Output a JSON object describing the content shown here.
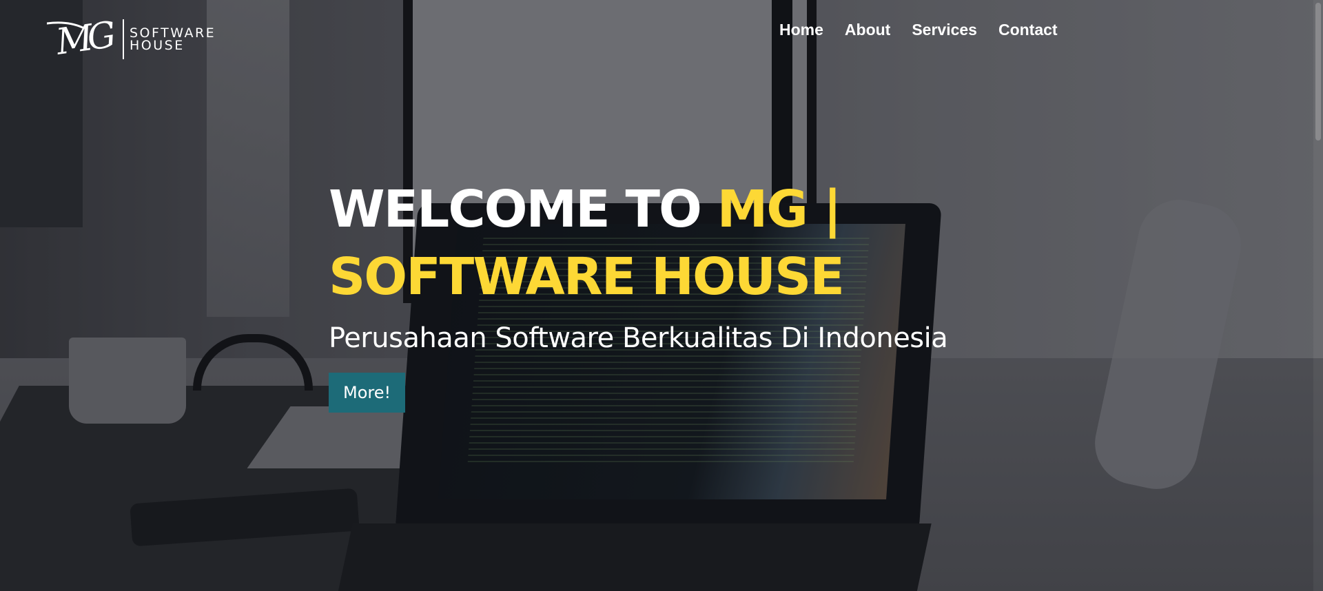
{
  "brand": {
    "logo_monogram": "MG",
    "logo_line1": "SOFTWARE",
    "logo_line2": "HOUSE"
  },
  "nav": {
    "items": [
      {
        "label": "Home"
      },
      {
        "label": "About"
      },
      {
        "label": "Services"
      },
      {
        "label": "Contact"
      }
    ]
  },
  "hero": {
    "title_white": "WELCOME TO ",
    "title_accent": "MG | SOFTWARE HOUSE",
    "subtitle": "Perusahaan Software Berkualitas Di Indonesia",
    "button_label": "More!"
  },
  "colors": {
    "accent_yellow": "#fdd835",
    "button_teal": "#1d6b78",
    "text_white": "#ffffff"
  }
}
